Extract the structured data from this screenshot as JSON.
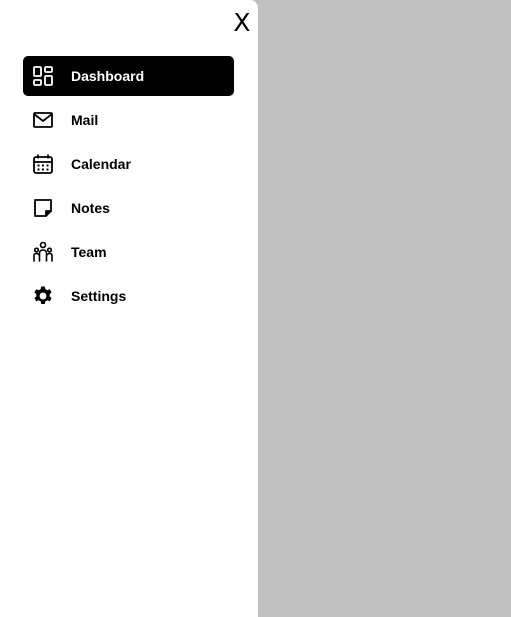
{
  "drawer": {
    "close_label": "X",
    "items": [
      {
        "label": "Dashboard",
        "icon": "dashboard-icon",
        "active": true
      },
      {
        "label": "Mail",
        "icon": "mail-icon",
        "active": false
      },
      {
        "label": "Calendar",
        "icon": "calendar-icon",
        "active": false
      },
      {
        "label": "Notes",
        "icon": "note-icon",
        "active": false
      },
      {
        "label": "Team",
        "icon": "team-icon",
        "active": false
      },
      {
        "label": "Settings",
        "icon": "gear-icon",
        "active": false
      }
    ]
  },
  "colors": {
    "drawer_bg": "#ffffff",
    "overlay_bg": "#c0c0c0",
    "active_bg": "#000000",
    "active_text": "#ffffff",
    "text": "#000000"
  }
}
